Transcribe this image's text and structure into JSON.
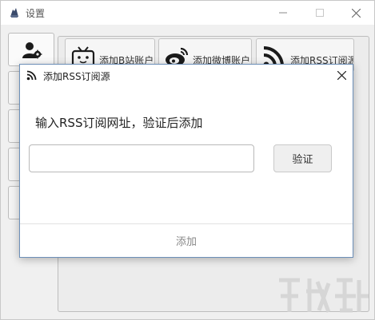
{
  "window": {
    "title": "设置",
    "icon": "app-logo-icon",
    "controls": [
      "minimize-icon",
      "maximize-icon",
      "close-icon"
    ]
  },
  "sidebar": {
    "items": [
      {
        "icon": "user-settings-icon",
        "active": true
      },
      {
        "icon": "",
        "active": false
      },
      {
        "icon": "",
        "active": false
      },
      {
        "icon": "",
        "active": false
      },
      {
        "icon": "",
        "active": false
      }
    ]
  },
  "toolbar": {
    "buttons": [
      {
        "label": "添加B站账户",
        "icon": "tv-icon"
      },
      {
        "label": "添加微博账户",
        "icon": "weibo-icon"
      },
      {
        "label": "添加RSS订阅源",
        "icon": "rss-icon"
      }
    ]
  },
  "dialog": {
    "title": "添加RSS订阅源",
    "icon": "rss-icon",
    "prompt": "输入RSS订阅网址，验证后添加",
    "input": {
      "value": "",
      "placeholder": ""
    },
    "verify_label": "验证",
    "add_label": "添加"
  },
  "colors": {
    "window_bg": "#f0f0f0",
    "dialog_border": "#6c8fb8",
    "button_bg": "#efefef"
  }
}
